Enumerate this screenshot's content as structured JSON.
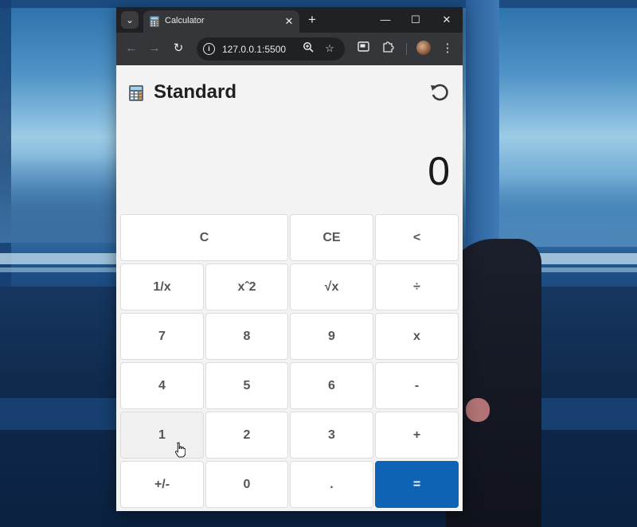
{
  "browser": {
    "tab_title": "Calculator",
    "url": "127.0.0.1:5500",
    "tab_search_icon": "chevron-down-icon",
    "close_tab_icon": "close-icon",
    "new_tab_icon": "plus-icon",
    "window_controls": [
      "minimize-icon",
      "maximize-icon",
      "close-icon"
    ],
    "toolbar_icons": [
      "back-icon",
      "forward-icon",
      "reload-icon",
      "info-icon",
      "zoom-icon",
      "star-icon",
      "picture-in-picture-icon",
      "extensions-icon",
      "avatar",
      "more-icon"
    ]
  },
  "calculator": {
    "mode_title": "Standard",
    "display_value": "0",
    "keys": {
      "clear": "C",
      "clear_entry": "CE",
      "backspace": "<",
      "reciprocal": "1/x",
      "square": "xˆ2",
      "sqrt": "√x",
      "divide": "÷",
      "seven": "7",
      "eight": "8",
      "nine": "9",
      "multiply": "x",
      "four": "4",
      "five": "5",
      "six": "6",
      "subtract": "-",
      "one": "1",
      "two": "2",
      "three": "3",
      "add": "+",
      "negate": "+/-",
      "zero": "0",
      "decimal": ".",
      "equals": "="
    },
    "accent_color": "#0f63b5",
    "hovered_key": "one"
  }
}
